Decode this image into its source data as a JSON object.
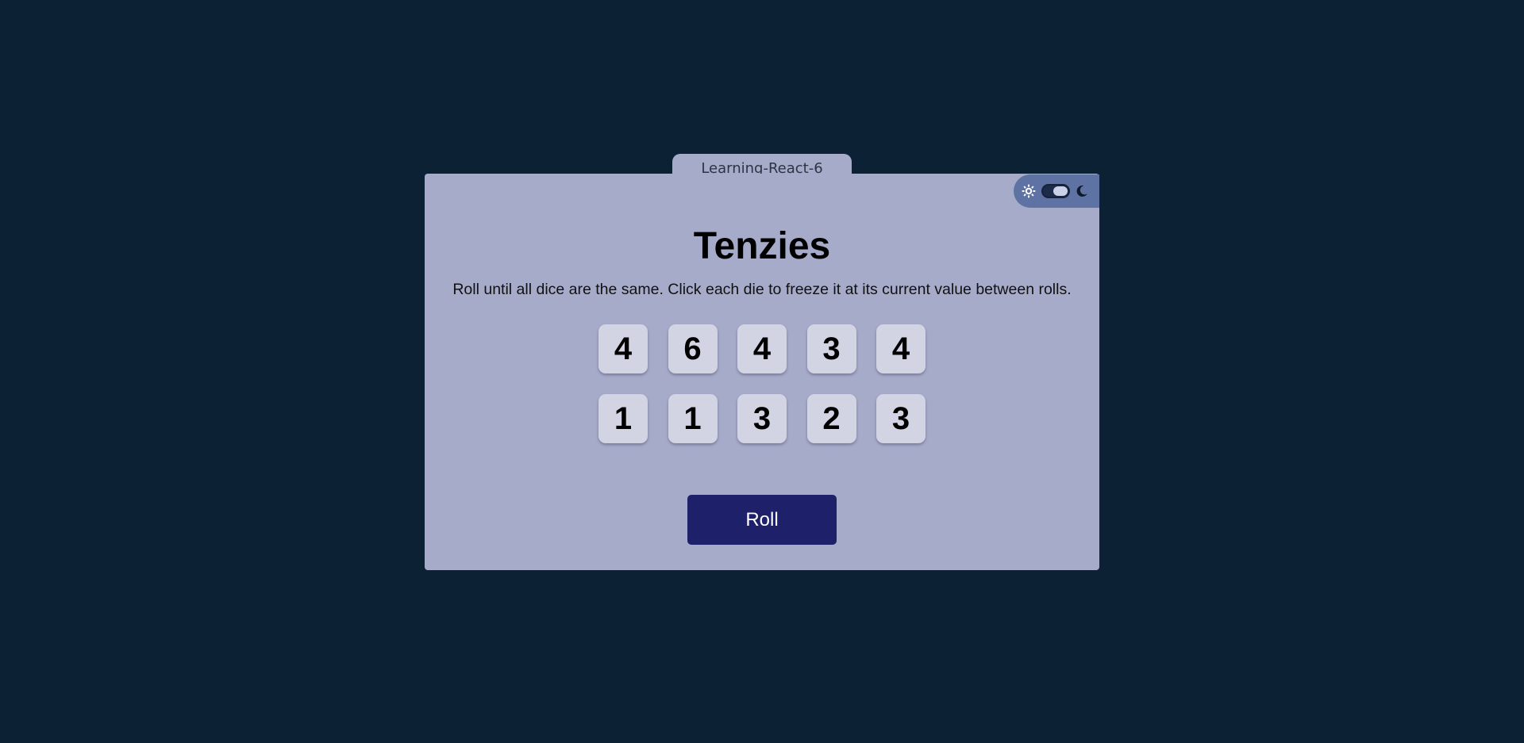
{
  "tab": {
    "title": "Learning-React-6"
  },
  "theme_toggle": {
    "sun_icon": "sun-icon",
    "moon_icon": "moon-icon",
    "mode": "dark",
    "colors": {
      "bg": "#5e73a3",
      "track": "#1c2b4a",
      "knob": "#c9d2e6"
    }
  },
  "game": {
    "title": "Tenzies",
    "instructions": "Roll until all dice are the same. Click each die to freeze it at its current value between rolls.",
    "dice": [
      {
        "value": "4"
      },
      {
        "value": "6"
      },
      {
        "value": "4"
      },
      {
        "value": "3"
      },
      {
        "value": "4"
      },
      {
        "value": "1"
      },
      {
        "value": "1"
      },
      {
        "value": "3"
      },
      {
        "value": "2"
      },
      {
        "value": "3"
      }
    ],
    "roll_label": "Roll"
  },
  "colors": {
    "page_bg": "#0c2234",
    "card_bg": "#a6abc9",
    "die_bg": "#d2d3e3",
    "button_bg": "#1e206a"
  }
}
